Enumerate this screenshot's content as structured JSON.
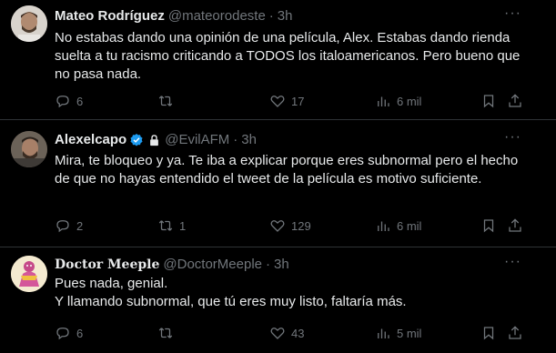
{
  "tweets": [
    {
      "name": "Mateo Rodríguez",
      "handle": "@mateorodeste",
      "time": "3h",
      "text": [
        "No estabas dando una opinión de una película, Alex. Estabas dando rienda suelta a tu racismo criticando a TODOS los italoamericanos. Pero bueno que no pasa nada."
      ],
      "replies": "6",
      "retweets": "",
      "likes": "17",
      "views": "6 mil"
    },
    {
      "name": "Alexelcapo",
      "handle": "@EvilAFM",
      "time": "3h",
      "text": [
        "Mira, te bloqueo y ya. Te iba a explicar porque eres subnormal pero el hecho de que no hayas entendido el tweet de la película es motivo suficiente."
      ],
      "replies": "2",
      "retweets": "1",
      "likes": "129",
      "views": "6 mil"
    },
    {
      "name": "Doctor Meeple",
      "handle": "@DoctorMeeple",
      "time": "3h",
      "text": [
        "Pues nada, genial.",
        "Y llamando subnormal, que tú eres muy listo, faltaría más."
      ],
      "replies": "6",
      "retweets": "",
      "likes": "43",
      "views": "5 mil"
    }
  ],
  "more_glyph": "···",
  "dot": "·",
  "colors": {
    "background": "#000000",
    "text": "#e7e9ea",
    "muted": "#71767b",
    "verified": "#1d9bf0",
    "divider": "#2f3336"
  }
}
